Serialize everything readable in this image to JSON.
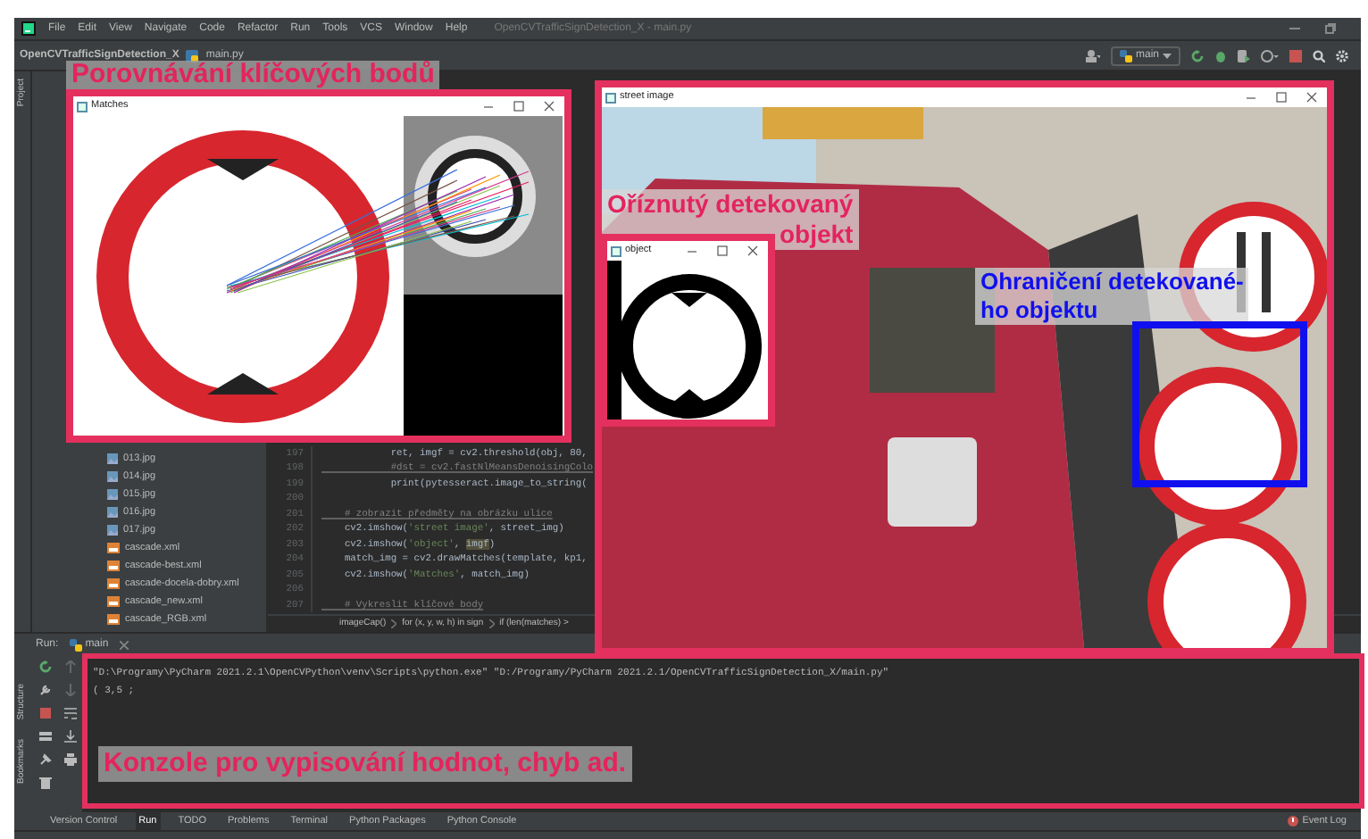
{
  "window": {
    "title": "OpenCVTrafficSignDetection_X - main.py"
  },
  "menu": [
    "File",
    "Edit",
    "View",
    "Navigate",
    "Code",
    "Refactor",
    "Run",
    "Tools",
    "VCS",
    "Window",
    "Help"
  ],
  "navigation": [
    "OpenCVTrafficSignDetection_X",
    "main.py"
  ],
  "run_config": "main",
  "side_tabs": {
    "top": [
      "Project"
    ],
    "bottom": [
      "Structure",
      "Bookmarks"
    ]
  },
  "project_tree": [
    {
      "name": "013.jpg",
      "kind": "image"
    },
    {
      "name": "014.jpg",
      "kind": "image"
    },
    {
      "name": "015.jpg",
      "kind": "image"
    },
    {
      "name": "016.jpg",
      "kind": "image"
    },
    {
      "name": "017.jpg",
      "kind": "image"
    },
    {
      "name": "cascade.xml",
      "kind": "xml"
    },
    {
      "name": "cascade-best.xml",
      "kind": "xml"
    },
    {
      "name": "cascade-docela-dobry.xml",
      "kind": "xml"
    },
    {
      "name": "cascade_new.xml",
      "kind": "xml"
    },
    {
      "name": "cascade_RGB.xml",
      "kind": "xml"
    }
  ],
  "editor": {
    "lines": [
      {
        "number": "197",
        "tokens": [
          {
            "text": "            ret, imgf = cv2.threshold(obj, 80,",
            "kind": "plain"
          }
        ]
      },
      {
        "number": "198",
        "tokens": [
          {
            "text": "            #dst = cv2.fastNlMeansDenoisingColo",
            "kind": "comment"
          }
        ]
      },
      {
        "number": "199",
        "tokens": [
          {
            "text": "            print(pytesseract.image_to_string(",
            "kind": "plain"
          }
        ]
      },
      {
        "number": "200"
      },
      {
        "number": "201",
        "tokens": [
          {
            "text": "    # zobrazit předměty na obrázku ulice",
            "kind": "comment"
          }
        ]
      },
      {
        "number": "202",
        "tokens": [
          {
            "text": "    cv2.imshow(",
            "kind": "plain"
          },
          {
            "text": "'street image'",
            "kind": "string"
          },
          {
            "text": ", street_img)",
            "kind": "plain"
          }
        ]
      },
      {
        "number": "203",
        "tokens": [
          {
            "text": "    cv2.imshow(",
            "kind": "plain"
          },
          {
            "text": "'object'",
            "kind": "string"
          },
          {
            "text": ", ",
            "kind": "plain"
          },
          {
            "text": "imgf",
            "kind": "highlight"
          },
          {
            "text": ")",
            "kind": "plain"
          }
        ]
      },
      {
        "number": "204",
        "tokens": [
          {
            "text": "    match_img = cv2.drawMatches(template, kp1,",
            "kind": "plain"
          }
        ]
      },
      {
        "number": "205",
        "tokens": [
          {
            "text": "    cv2.imshow(",
            "kind": "plain"
          },
          {
            "text": "'Matches'",
            "kind": "string"
          },
          {
            "text": ", match_img)",
            "kind": "plain"
          }
        ]
      },
      {
        "number": "206"
      },
      {
        "number": "207",
        "tokens": [
          {
            "text": "    # Vykreslit klíčové body",
            "kind": "comment"
          }
        ]
      }
    ],
    "breadcrumb": [
      "imageCap()",
      "for (x, y, w, h) in sign",
      "if (len(matches) >"
    ]
  },
  "run_panel": {
    "label": "Run:",
    "tab": "main",
    "console": [
      "\"D:\\Programy\\PyCharm 2021.2.1\\OpenCVPython\\venv\\Scripts\\python.exe\" \"D:/Programy/PyCharm 2021.2.1/OpenCVTrafficSignDetection_X/main.py\"",
      "( 3,5 ;"
    ]
  },
  "bottom_tabs": [
    {
      "label": "Version Control",
      "selected": false
    },
    {
      "label": "Run",
      "selected": true
    },
    {
      "label": "TODO",
      "selected": false
    },
    {
      "label": "Problems",
      "selected": false
    },
    {
      "label": "Terminal",
      "selected": false
    },
    {
      "label": "Python Packages",
      "selected": false
    },
    {
      "label": "Python Console",
      "selected": false
    }
  ],
  "event_log": "Event Log",
  "image_windows": [
    {
      "title": "Matches"
    },
    {
      "title": "street image"
    },
    {
      "title": "object"
    }
  ],
  "annotations": {
    "matches": "Porovnávání klíčových bodů",
    "cropped": "Oříznutý detekovaný\nobjekt",
    "bounding": "Ohraničení detekované-\nho objektu",
    "console": "Konzole pro vypisování hodnot, chyb ad."
  }
}
